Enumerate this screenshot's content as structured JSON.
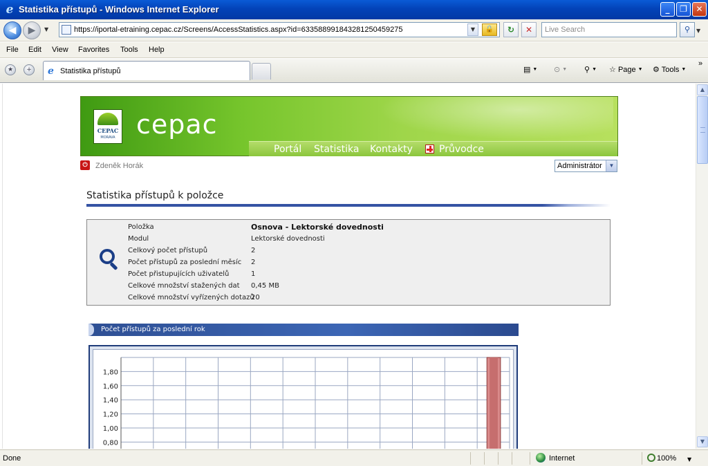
{
  "window": {
    "title": "Statistika přístupů - Windows Internet Explorer",
    "minimize_glyph": "_",
    "restore_glyph": "❐",
    "close_glyph": "✕"
  },
  "address": {
    "url": "https://iportal-etraining.cepac.cz/Screens/AccessStatistics.aspx?id=633588991843281250459275",
    "search_placeholder": "Live Search"
  },
  "menu": [
    "File",
    "Edit",
    "View",
    "Favorites",
    "Tools",
    "Help"
  ],
  "tab": {
    "label": "Statistika přístupů"
  },
  "commands": {
    "page": "Page",
    "tools": "Tools",
    "more": "»"
  },
  "site": {
    "logo_line1": "CEPAC",
    "logo_line2": "MORAVA",
    "brand": "cepac",
    "nav": [
      "Portál",
      "Statistika",
      "Kontakty",
      "Průvodce"
    ],
    "user": "Zdeněk Horák",
    "role": "Administrátor",
    "page_title": "Statistika přístupů k položce"
  },
  "info": [
    {
      "label": "Položka",
      "value": "Osnova - Lektorské dovednosti"
    },
    {
      "label": "Modul",
      "value": "Lektorské dovednosti"
    },
    {
      "label": "Celkový počet přístupů",
      "value": "2"
    },
    {
      "label": "Počet přístupů za poslední měsíc",
      "value": "2"
    },
    {
      "label": "Počet přistupujících uživatelů",
      "value": "1"
    },
    {
      "label": "Celkové množství stažených dat",
      "value": "0,45 MB"
    },
    {
      "label": "Celkové množství vyřízených dotazů",
      "value": "20"
    }
  ],
  "section_title": "Počet přístupů za poslední rok",
  "chart_data": {
    "type": "bar",
    "y_ticks": [
      "1,80",
      "1,60",
      "1,40",
      "1,20",
      "1,00",
      "0,80"
    ],
    "ylim": [
      0,
      2
    ],
    "categories_count": 12,
    "values": [
      0,
      0,
      0,
      0,
      0,
      0,
      0,
      0,
      0,
      0,
      0,
      2
    ],
    "bar_color": "#d98a8a",
    "bar_edge_color": "#8a3a3a",
    "grid": true
  },
  "status": {
    "text": "Done",
    "zone": "Internet",
    "zoom": "100%"
  }
}
